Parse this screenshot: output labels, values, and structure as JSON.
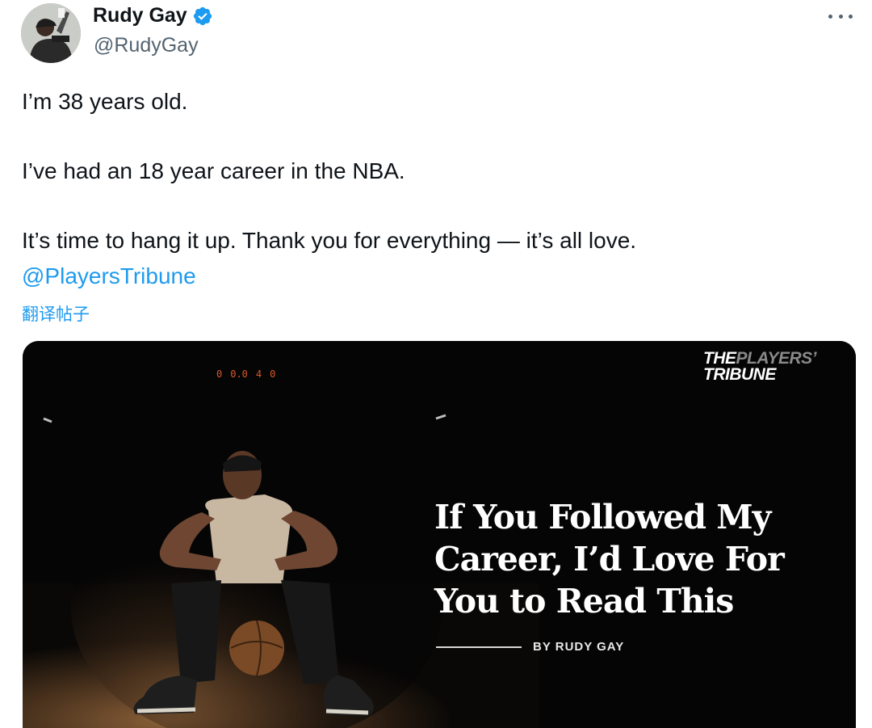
{
  "author": {
    "display_name": "Rudy Gay",
    "handle": "@RudyGay",
    "verified": true,
    "avatar_icon": "avatar-photo"
  },
  "tweet": {
    "lines": [
      "I’m 38 years old.",
      "I’ve had an 18 year career in the NBA.",
      "It’s time to hang it up. Thank you for everything — it’s all love."
    ],
    "mention": "@PlayersTribune",
    "translate_label": "翻译帖子"
  },
  "card": {
    "brand_the": "THE",
    "brand_players": "PLAYERS’",
    "brand_tribune": "TRIBUNE",
    "headline": "If You Followed My Career, I’d Love For You to Read This",
    "byline": "BY RUDY GAY",
    "scoreboard": [
      "0",
      "0.0",
      "4",
      "0"
    ]
  },
  "colors": {
    "link": "#1d9bf0",
    "text": "#0f1419",
    "secondary": "#536471",
    "verified": "#1d9bf0"
  }
}
